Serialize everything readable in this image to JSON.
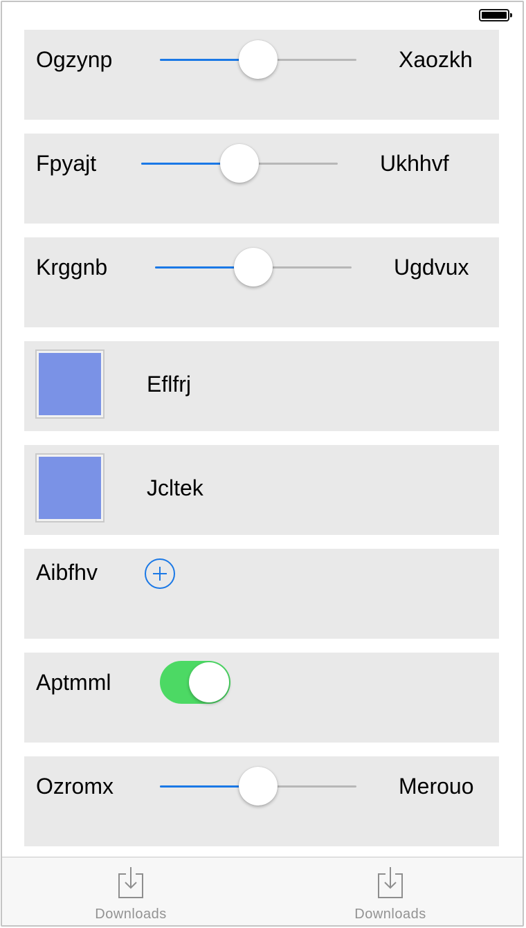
{
  "colors": {
    "slider_fill": "#1a78e6",
    "slider_track": "#b7b7b7",
    "toggle_on": "#4cd964",
    "row_background": "#e9e9e9",
    "accent": "#1a78e6"
  },
  "rows": [
    {
      "type": "slider",
      "min_label": "Ogzynp",
      "max_label": "Xaozkh",
      "value": 0.5
    },
    {
      "type": "slider",
      "min_label": "Fpyajt",
      "max_label": "Ukhhvf",
      "value": 0.5
    },
    {
      "type": "slider",
      "min_label": "Krggnb",
      "max_label": "Ugdvux",
      "value": 0.5
    },
    {
      "type": "color",
      "label": "Eflfrj",
      "color": "#7a92e6"
    },
    {
      "type": "color",
      "label": "Jcltek",
      "color": "#7a92e6"
    },
    {
      "type": "add",
      "label": "Aibfhv",
      "icon": "plus-circle-icon"
    },
    {
      "type": "toggle",
      "label": "Aptmml",
      "on": true
    },
    {
      "type": "slider",
      "min_label": "Ozromx",
      "max_label": "Merouo",
      "value": 0.5
    }
  ],
  "tab_bar": {
    "items": [
      {
        "label": "Downloads",
        "icon": "download-tray-icon"
      },
      {
        "label": "Downloads",
        "icon": "download-tray-icon"
      }
    ]
  },
  "status_bar": {
    "battery_icon": "battery-full-icon",
    "battery_level": 1.0
  }
}
